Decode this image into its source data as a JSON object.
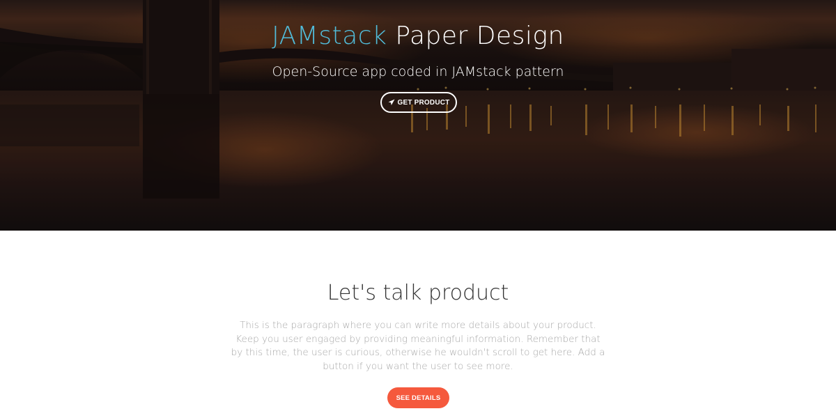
{
  "hero": {
    "title_accent": "JAMstack",
    "title_rest": " Paper Design",
    "subtitle": "Open-Source app coded in JAMstack pattern",
    "button_label": "GET PRODUCT",
    "button_icon": "rocket-icon"
  },
  "section": {
    "title": "Let's talk product",
    "description": "This is the paragraph where you can write more details about your product. Keep you user engaged by providing meaningful information. Remember that by this time, the user is curious, otherwise he wouldn't scroll to get here. Add a button if you want the user to see more.",
    "button_label": "SEE DETAILS"
  },
  "colors": {
    "accent": "#51bcda",
    "danger": "#f5593d",
    "text": "#333333",
    "muted": "#a8a8a8"
  }
}
